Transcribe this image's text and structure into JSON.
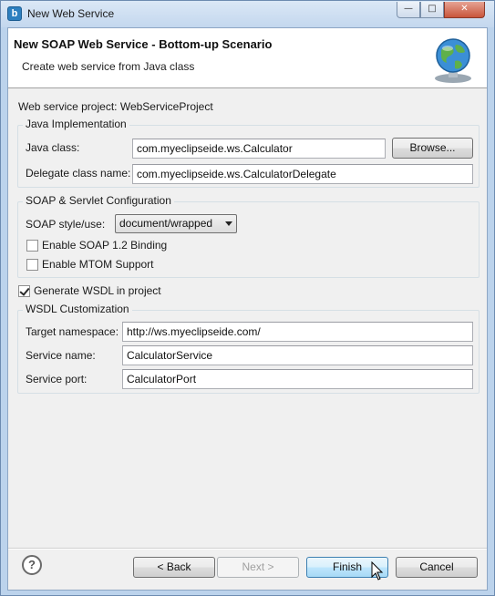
{
  "window": {
    "title": "New Web Service",
    "app_icon_glyph": "b",
    "controls": {
      "minimize": "—",
      "maximize": "□",
      "close": "✕"
    }
  },
  "banner": {
    "title": "New SOAP Web Service - Bottom-up Scenario",
    "description": "Create web service from Java class",
    "icon": "globe-web-service-icon"
  },
  "project": {
    "label": "Web service project:",
    "value": "WebServiceProject"
  },
  "java_impl": {
    "group_title": "Java Implementation",
    "java_class_label": "Java class:",
    "java_class_value": "com.myeclipseide.ws.Calculator",
    "browse_label": "Browse...",
    "delegate_label": "Delegate class name:",
    "delegate_value": "com.myeclipseide.ws.CalculatorDelegate"
  },
  "soap_config": {
    "group_title": "SOAP & Servlet Configuration",
    "style_label": "SOAP style/use:",
    "style_value": "document/wrapped",
    "soap12_label": "Enable SOAP 1.2 Binding",
    "soap12_checked": false,
    "mtom_label": "Enable MTOM Support",
    "mtom_checked": false
  },
  "wsdl": {
    "generate_label": "Generate WSDL in project",
    "generate_checked": true,
    "group_title": "WSDL Customization",
    "namespace_label": "Target namespace:",
    "namespace_value": "http://ws.myeclipseide.com/",
    "service_name_label": "Service name:",
    "service_name_value": "CalculatorService",
    "service_port_label": "Service port:",
    "service_port_value": "CalculatorPort"
  },
  "footer": {
    "help_glyph": "?",
    "back_label": "< Back",
    "next_label": "Next >",
    "finish_label": "Finish",
    "cancel_label": "Cancel"
  },
  "colors": {
    "window_frame": "#bcd3ec",
    "dialog_bg": "#f0f0f0",
    "default_button": "#bee6fd"
  }
}
